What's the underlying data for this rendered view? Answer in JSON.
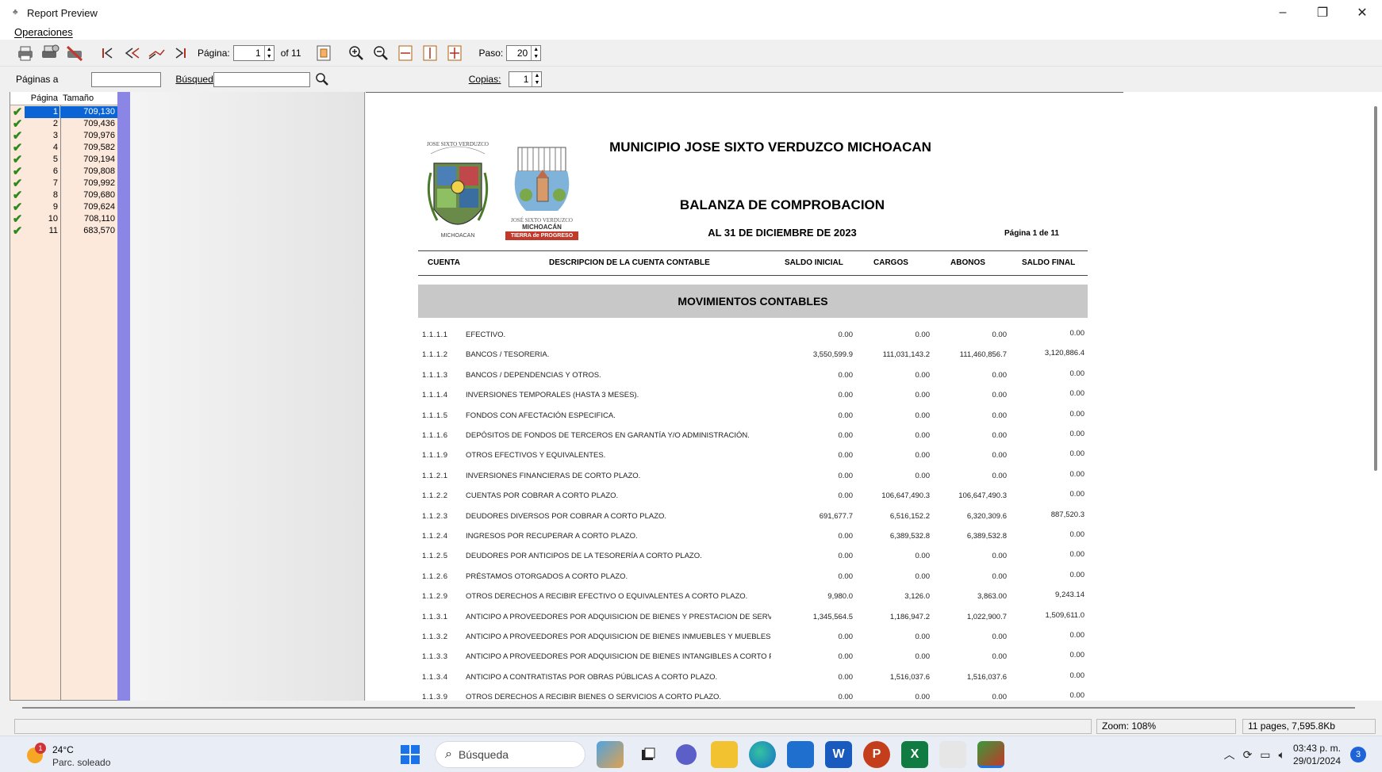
{
  "window": {
    "title": "Report Preview",
    "minimize": "–",
    "restore": "❐",
    "close": "✕"
  },
  "menu": {
    "operaciones": "Operaciones"
  },
  "toolbar": {
    "pagina_label": "Página:",
    "pagina_value": "1",
    "of_label": "of 11",
    "paso_label": "Paso:",
    "paso_value": "20"
  },
  "row2": {
    "paginas_label": "Páginas a",
    "paginas_value": "",
    "busqueda_label": "Búsqued",
    "busqueda_value": "",
    "copias_label": "Copias:",
    "copias_value": "1"
  },
  "pages_grid": {
    "headers": [
      "Página",
      "Tamaño"
    ],
    "rows": [
      {
        "page": "1",
        "size": "709,130"
      },
      {
        "page": "2",
        "size": "709,436"
      },
      {
        "page": "3",
        "size": "709,976"
      },
      {
        "page": "4",
        "size": "709,582"
      },
      {
        "page": "5",
        "size": "709,194"
      },
      {
        "page": "6",
        "size": "709,808"
      },
      {
        "page": "7",
        "size": "709,992"
      },
      {
        "page": "8",
        "size": "709,680"
      },
      {
        "page": "9",
        "size": "709,624"
      },
      {
        "page": "10",
        "size": "708,110"
      },
      {
        "page": "11",
        "size": "683,570"
      }
    ]
  },
  "document": {
    "title": "MUNICIPIO JOSE SIXTO VERDUZCO MICHOACAN",
    "subtitle": "BALANZA DE COMPROBACION",
    "date": "AL 31 DE DICIEMBRE DE 2023",
    "page_info": "Página  1  de  11",
    "logo1_text_top": "JOSE SIXTO VERDUZCO",
    "logo1_text_bottom": "MICHOACAN",
    "logo2_text1": "JOSÉ SIXTO VERDUZCO",
    "logo2_text2": "MICHOACÁN",
    "logo2_text3": "TIERRA de PROGRESO",
    "columns": {
      "cuenta": "CUENTA",
      "descripcion": "DESCRIPCION DE LA CUENTA CONTABLE",
      "saldo_inicial": "SALDO INICIAL",
      "cargos": "CARGOS",
      "abonos": "ABONOS",
      "saldo_final": "SALDO FINAL"
    },
    "section": "MOVIMIENTOS CONTABLES",
    "rows": [
      {
        "code": "1.1.1.1",
        "desc": "EFECTIVO.",
        "si": "0.00",
        "ca": "0.00",
        "ab": "0.00",
        "sf": "0.00"
      },
      {
        "code": "1.1.1.2",
        "desc": "BANCOS / TESORERIA.",
        "si": "3,550,599.9",
        "ca": "111,031,143.2",
        "ab": "111,460,856.7",
        "sf": "3,120,886.4"
      },
      {
        "code": "1.1.1.3",
        "desc": "BANCOS / DEPENDENCIAS Y OTROS.",
        "si": "0.00",
        "ca": "0.00",
        "ab": "0.00",
        "sf": "0.00"
      },
      {
        "code": "1.1.1.4",
        "desc": "INVERSIONES TEMPORALES (HASTA 3 MESES).",
        "si": "0.00",
        "ca": "0.00",
        "ab": "0.00",
        "sf": "0.00"
      },
      {
        "code": "1.1.1.5",
        "desc": "FONDOS CON AFECTACIÓN ESPECIFICA.",
        "si": "0.00",
        "ca": "0.00",
        "ab": "0.00",
        "sf": "0.00"
      },
      {
        "code": "1.1.1.6",
        "desc": "DEPÓSITOS DE FONDOS DE TERCEROS EN GARANTÍA Y/O ADMINISTRACIÓN.",
        "si": "0.00",
        "ca": "0.00",
        "ab": "0.00",
        "sf": "0.00"
      },
      {
        "code": "1.1.1.9",
        "desc": "OTROS EFECTIVOS Y EQUIVALENTES.",
        "si": "0.00",
        "ca": "0.00",
        "ab": "0.00",
        "sf": "0.00"
      },
      {
        "code": "1.1.2.1",
        "desc": "INVERSIONES FINANCIERAS DE CORTO PLAZO.",
        "si": "0.00",
        "ca": "0.00",
        "ab": "0.00",
        "sf": "0.00"
      },
      {
        "code": "1.1.2.2",
        "desc": "CUENTAS POR COBRAR A CORTO PLAZO.",
        "si": "0.00",
        "ca": "106,647,490.3",
        "ab": "106,647,490.3",
        "sf": "0.00"
      },
      {
        "code": "1.1.2.3",
        "desc": "DEUDORES DIVERSOS POR COBRAR A CORTO PLAZO.",
        "si": "691,677.7",
        "ca": "6,516,152.2",
        "ab": "6,320,309.6",
        "sf": "887,520.3"
      },
      {
        "code": "1.1.2.4",
        "desc": "INGRESOS POR RECUPERAR A CORTO PLAZO.",
        "si": "0.00",
        "ca": "6,389,532.8",
        "ab": "6,389,532.8",
        "sf": "0.00"
      },
      {
        "code": "1.1.2.5",
        "desc": "DEUDORES POR ANTICIPOS DE LA TESORERÍA A CORTO PLAZO.",
        "si": "0.00",
        "ca": "0.00",
        "ab": "0.00",
        "sf": "0.00"
      },
      {
        "code": "1.1.2.6",
        "desc": "PRÉSTAMOS OTORGADOS A CORTO PLAZO.",
        "si": "0.00",
        "ca": "0.00",
        "ab": "0.00",
        "sf": "0.00"
      },
      {
        "code": "1.1.2.9",
        "desc": "OTROS DERECHOS A RECIBIR EFECTIVO O EQUIVALENTES A CORTO PLAZO.",
        "si": "9,980.0",
        "ca": "3,126.0",
        "ab": "3,863.00",
        "sf": "9,243.14"
      },
      {
        "code": "1.1.3.1",
        "desc": "ANTICIPO A PROVEEDORES POR ADQUISICION DE BIENES Y PRESTACION DE SERVICIOS A C(",
        "si": "1,345,564.5",
        "ca": "1,186,947.2",
        "ab": "1,022,900.7",
        "sf": "1,509,611.0"
      },
      {
        "code": "1.1.3.2",
        "desc": "ANTICIPO A PROVEEDORES POR ADQUISICION DE BIENES INMUEBLES Y MUEBLES A CORTO I",
        "si": "0.00",
        "ca": "0.00",
        "ab": "0.00",
        "sf": "0.00"
      },
      {
        "code": "1.1.3.3",
        "desc": "ANTICIPO A PROVEEDORES POR ADQUISICION DE BIENES INTANGIBLES A CORTO PLAZO.",
        "si": "0.00",
        "ca": "0.00",
        "ab": "0.00",
        "sf": "0.00"
      },
      {
        "code": "1.1.3.4",
        "desc": "ANTICIPO A CONTRATISTAS POR OBRAS PÚBLICAS A CORTO PLAZO.",
        "si": "0.00",
        "ca": "1,516,037.6",
        "ab": "1,516,037.6",
        "sf": "0.00"
      },
      {
        "code": "1.1.3.9",
        "desc": "OTROS DERECHOS A RECIBIR BIENES O SERVICIOS A CORTO PLAZO.",
        "si": "0.00",
        "ca": "0.00",
        "ab": "0.00",
        "sf": "0.00"
      }
    ]
  },
  "status": {
    "zoom": "Zoom: 108%",
    "pages": "11 pages, 7,595.8Kb"
  },
  "taskbar": {
    "temp": "24°C",
    "condition": "Parc. soleado",
    "weather_badge": "1",
    "search": "Búsqueda",
    "time": "03:43 p. m.",
    "date": "29/01/2024",
    "notif_count": "3"
  },
  "colors": {
    "selection": "#0a64d6",
    "grid_bg": "#fde8dc",
    "strip": "#8b86e6",
    "section_band": "#c8c8c8"
  }
}
